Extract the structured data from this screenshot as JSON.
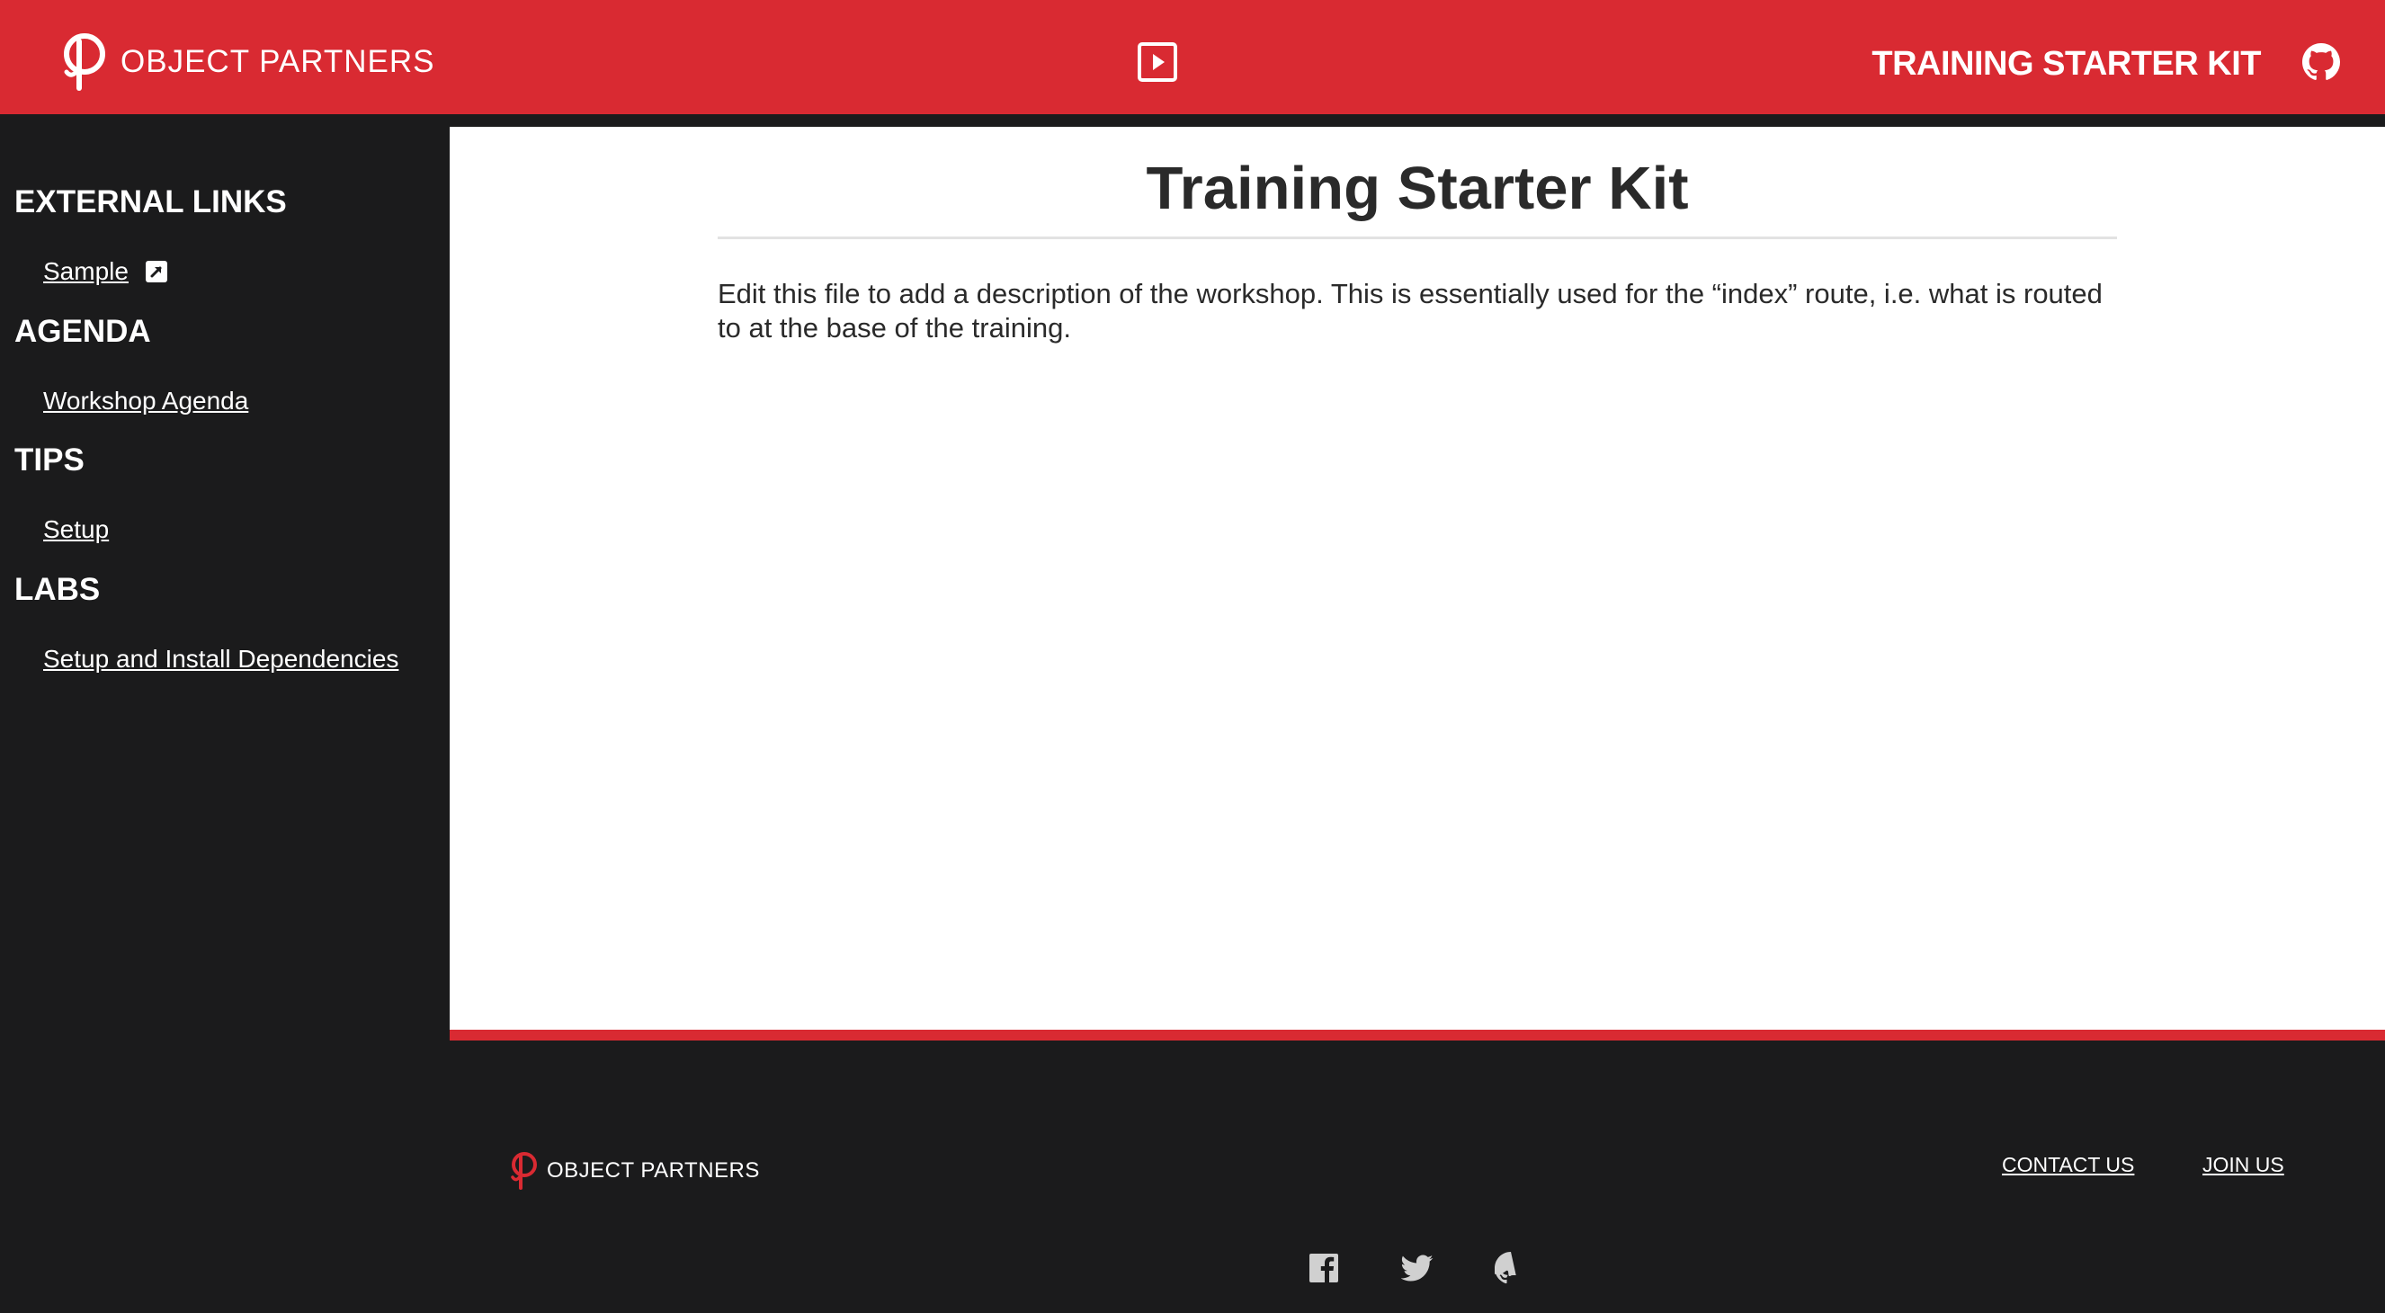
{
  "header": {
    "logo_text": "OBJECT PARTNERS",
    "kit_title": "TRAINING STARTER KIT",
    "brand_color": "#d92a32",
    "present_icon": "play-square-icon",
    "repo_icon": "github-icon"
  },
  "sidebar": {
    "sections": [
      {
        "heading": "EXTERNAL LINKS",
        "links": [
          {
            "label": "Sample",
            "icon": "external-link-icon"
          }
        ]
      },
      {
        "heading": "AGENDA",
        "links": [
          {
            "label": "Workshop Agenda"
          }
        ]
      },
      {
        "heading": "TIPS",
        "links": [
          {
            "label": "Setup"
          }
        ]
      },
      {
        "heading": "LABS",
        "links": [
          {
            "label": "Setup and Install Dependencies"
          }
        ]
      }
    ]
  },
  "main": {
    "title": "Training Starter Kit",
    "description": "Edit this file to add a description of the workshop. This is essentially used for the “index” route, i.e. what is routed to at the base of the training."
  },
  "footer": {
    "logo_text": "OBJECT PARTNERS",
    "links": [
      {
        "label": "CONTACT US"
      },
      {
        "label": "JOIN US"
      }
    ],
    "social_icons": [
      "facebook-icon",
      "twitter-icon",
      "github-icon"
    ]
  }
}
